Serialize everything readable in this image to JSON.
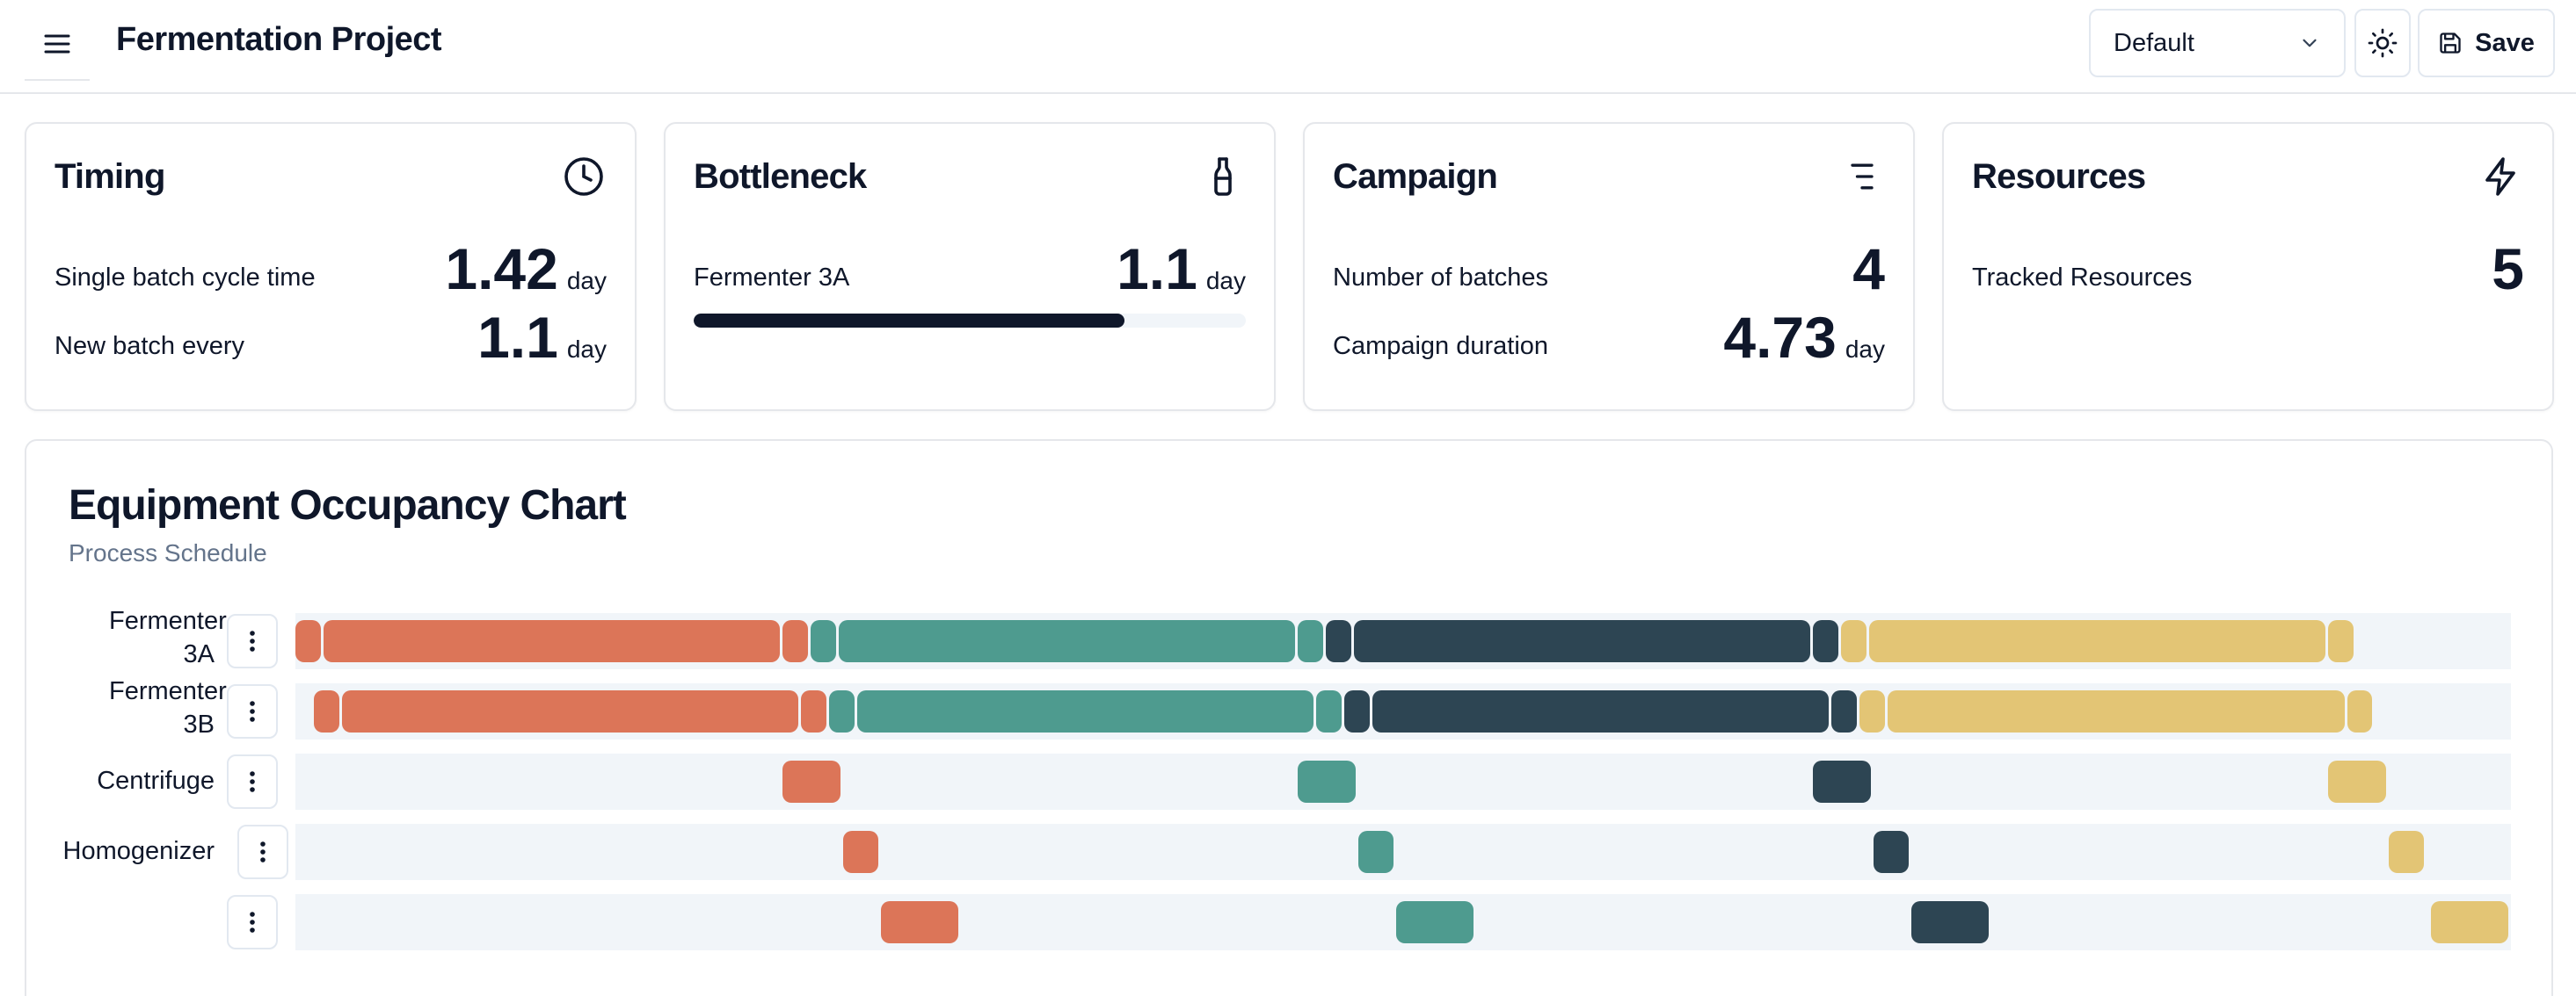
{
  "header": {
    "title": "Fermentation Project",
    "view_select_value": "Default",
    "save_label": "Save"
  },
  "cards": {
    "timing": {
      "title": "Timing",
      "rows": [
        {
          "label": "Single batch cycle time",
          "value": "1.42",
          "unit": "day"
        },
        {
          "label": "New batch every",
          "value": "1.1",
          "unit": "day"
        }
      ]
    },
    "bottleneck": {
      "title": "Bottleneck",
      "label": "Fermenter 3A",
      "value": "1.1",
      "unit": "day",
      "utilization_fraction": 0.78
    },
    "campaign": {
      "title": "Campaign",
      "rows": [
        {
          "label": "Number of batches",
          "value": "4",
          "unit": ""
        },
        {
          "label": "Campaign duration",
          "value": "4.73",
          "unit": "day"
        }
      ]
    },
    "resources": {
      "title": "Resources",
      "label": "Tracked Resources",
      "value": "5"
    }
  },
  "chart": {
    "title": "Equipment Occupancy Chart",
    "subtitle": "Process Schedule"
  },
  "chart_data": {
    "type": "gantt",
    "domain": [
      0,
      4.73
    ],
    "batch_colors": [
      "#dc7558",
      "#4e9b8f",
      "#2d4553",
      "#e3c575"
    ],
    "resources": [
      {
        "label": "Fermenter 3A",
        "segments": [
          {
            "batch": 1,
            "start": 0.0,
            "end": 0.06
          },
          {
            "batch": 1,
            "start": 0.06,
            "end": 1.04
          },
          {
            "batch": 1,
            "start": 1.04,
            "end": 1.1
          },
          {
            "batch": 2,
            "start": 1.1,
            "end": 1.16
          },
          {
            "batch": 2,
            "start": 1.16,
            "end": 2.14
          },
          {
            "batch": 2,
            "start": 2.14,
            "end": 2.2
          },
          {
            "batch": 3,
            "start": 2.2,
            "end": 2.26
          },
          {
            "batch": 3,
            "start": 2.26,
            "end": 3.24
          },
          {
            "batch": 3,
            "start": 3.24,
            "end": 3.3
          },
          {
            "batch": 4,
            "start": 3.3,
            "end": 3.36
          },
          {
            "batch": 4,
            "start": 3.36,
            "end": 4.34
          },
          {
            "batch": 4,
            "start": 4.34,
            "end": 4.4
          }
        ]
      },
      {
        "label": "Fermenter 3B",
        "segments": [
          {
            "batch": 1,
            "start": 0.04,
            "end": 0.1
          },
          {
            "batch": 1,
            "start": 0.1,
            "end": 1.08
          },
          {
            "batch": 1,
            "start": 1.08,
            "end": 1.14
          },
          {
            "batch": 2,
            "start": 1.14,
            "end": 1.2
          },
          {
            "batch": 2,
            "start": 1.2,
            "end": 2.18
          },
          {
            "batch": 2,
            "start": 2.18,
            "end": 2.24
          },
          {
            "batch": 3,
            "start": 2.24,
            "end": 2.3
          },
          {
            "batch": 3,
            "start": 2.3,
            "end": 3.28
          },
          {
            "batch": 3,
            "start": 3.28,
            "end": 3.34
          },
          {
            "batch": 4,
            "start": 3.34,
            "end": 3.4
          },
          {
            "batch": 4,
            "start": 3.4,
            "end": 4.38
          },
          {
            "batch": 4,
            "start": 4.38,
            "end": 4.44
          }
        ]
      },
      {
        "label": "Centrifuge",
        "segments": [
          {
            "batch": 1,
            "start": 1.04,
            "end": 1.17
          },
          {
            "batch": 2,
            "start": 2.14,
            "end": 2.27
          },
          {
            "batch": 3,
            "start": 3.24,
            "end": 3.37
          },
          {
            "batch": 4,
            "start": 4.34,
            "end": 4.47
          }
        ]
      },
      {
        "label": "Homogenizer",
        "segments": [
          {
            "batch": 1,
            "start": 1.17,
            "end": 1.25
          },
          {
            "batch": 2,
            "start": 2.27,
            "end": 2.35
          },
          {
            "batch": 3,
            "start": 3.37,
            "end": 3.45
          },
          {
            "batch": 4,
            "start": 4.47,
            "end": 4.55
          }
        ]
      },
      {
        "label": "",
        "segments": [
          {
            "batch": 1,
            "start": 1.25,
            "end": 1.42
          },
          {
            "batch": 2,
            "start": 2.35,
            "end": 2.52
          },
          {
            "batch": 3,
            "start": 3.45,
            "end": 3.62
          },
          {
            "batch": 4,
            "start": 4.56,
            "end": 4.73
          }
        ]
      }
    ]
  }
}
